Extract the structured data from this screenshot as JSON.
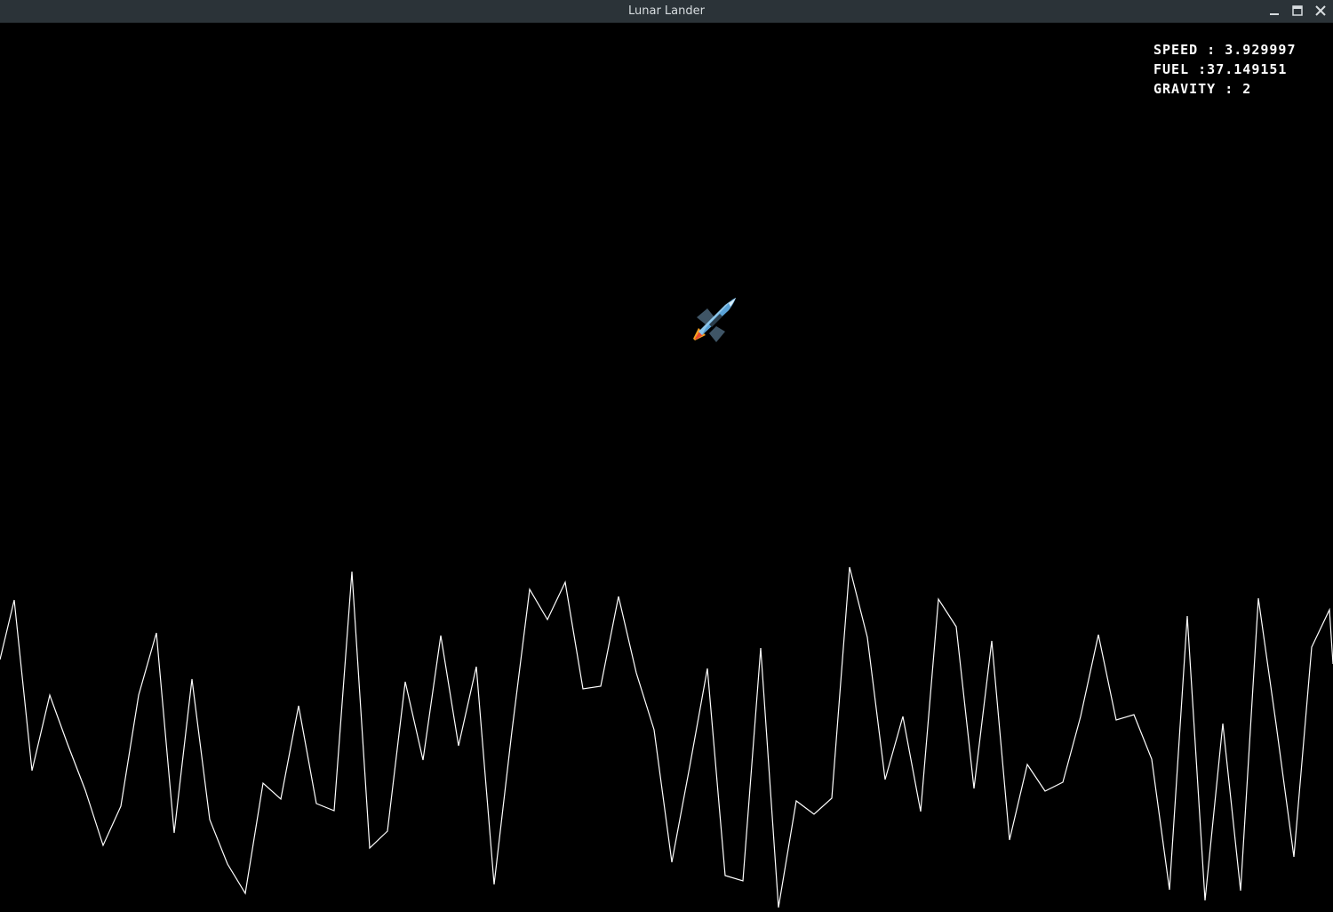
{
  "window": {
    "title": "Lunar Lander",
    "buttons": [
      "minimize",
      "maximize",
      "close"
    ]
  },
  "hud": {
    "speed": "SPEED : 3.929997",
    "fuel": "FUEL :37.149151",
    "gravity": "GRAVITY : 2"
  },
  "ship": {
    "icon": "rocket-icon"
  },
  "colors": {
    "background": "#000000",
    "terrain": "#ffffff",
    "titlebar": "#2b3338"
  }
}
